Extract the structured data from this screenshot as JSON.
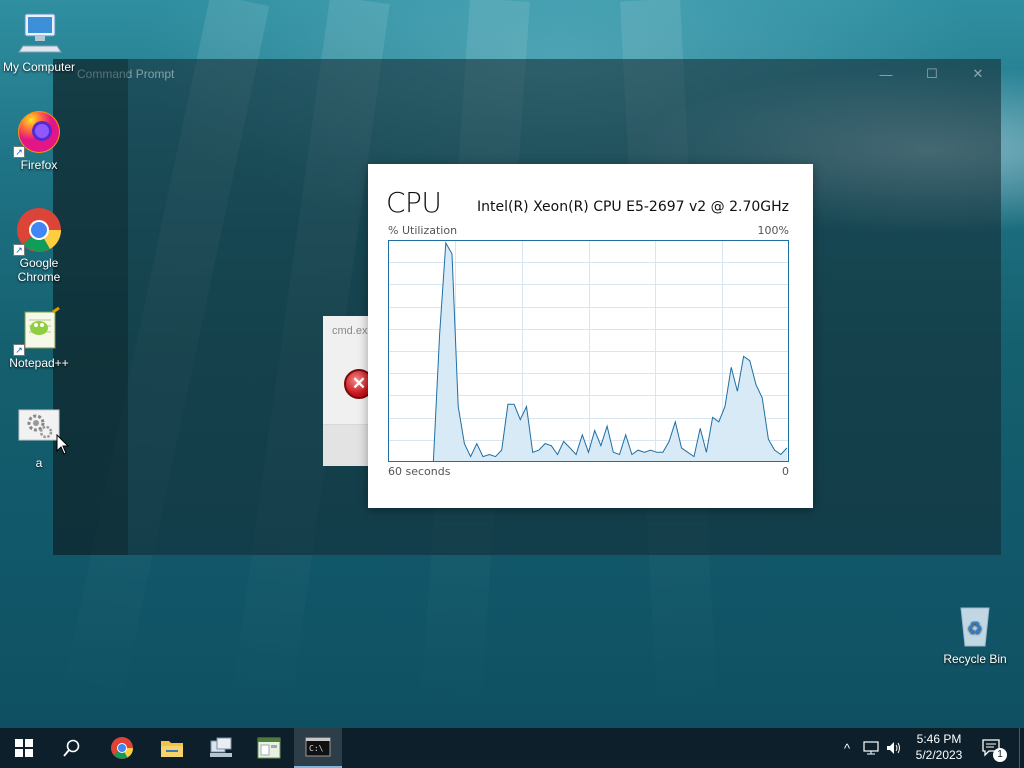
{
  "desktop": {
    "icons": [
      {
        "label": "My Computer"
      },
      {
        "label": "Firefox"
      },
      {
        "label": "Google Chrome"
      },
      {
        "label": "Notepad++"
      },
      {
        "label": "a"
      },
      {
        "label": "Recycle Bin"
      }
    ]
  },
  "cmd_window": {
    "title": "Command Prompt",
    "controls": {
      "minimize": "—",
      "maximize": "☐",
      "close": "✕"
    }
  },
  "error_dialog": {
    "title": "cmd.ex",
    "icon": "error-icon"
  },
  "cpu_panel": {
    "title": "CPU",
    "model": "Intel(R) Xeon(R) CPU E5-2697 v2 @ 2.70GHz",
    "y_label": "% Utilization",
    "y_max_label": "100%",
    "x_left_label": "60 seconds",
    "x_right_label": "0",
    "accent_color": "#1f6fa5",
    "fill_color": "#d8eaf6"
  },
  "chart_data": {
    "type": "area",
    "ylim": [
      0,
      100
    ],
    "xlim": [
      60,
      0
    ],
    "x_direction": "seconds ago, left=60 right=0",
    "values": [
      0,
      0,
      0,
      0,
      0,
      0,
      0,
      0,
      58,
      100,
      95,
      25,
      8,
      2,
      8,
      2,
      3,
      2,
      5,
      26,
      26,
      19,
      25,
      4,
      5,
      8,
      7,
      3,
      9,
      6,
      3,
      12,
      4,
      14,
      7,
      16,
      4,
      3,
      12,
      3,
      5,
      4,
      5,
      4,
      4,
      9,
      18,
      6,
      4,
      2,
      15,
      4,
      20,
      18,
      25,
      43,
      32,
      48,
      46,
      35,
      29,
      10,
      5,
      3,
      6
    ]
  },
  "taskbar": {
    "buttons": [
      {
        "name": "start-button"
      },
      {
        "name": "search-button"
      },
      {
        "name": "chrome-taskbar-button"
      },
      {
        "name": "file-explorer-taskbar-button"
      },
      {
        "name": "network-app-taskbar-button"
      },
      {
        "name": "app-taskbar-button"
      },
      {
        "name": "command-prompt-taskbar-button"
      }
    ],
    "tray": {
      "chevron": "^",
      "time": "5:46 PM",
      "date": "5/2/2023",
      "notification_count": "1"
    }
  }
}
